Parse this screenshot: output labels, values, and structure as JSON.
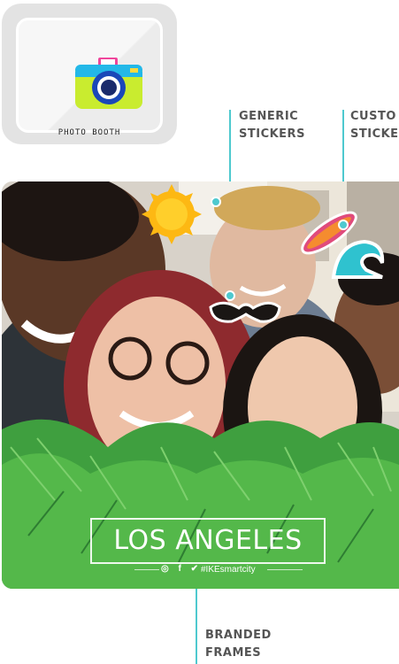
{
  "app_tile": {
    "label": "PHOTO BOOTH",
    "icon": "camera-icon"
  },
  "callouts": {
    "generic": "GENERIC\nSTICKERS",
    "custom": "CUSTO\nSTICKE",
    "branded": "BRANDED\nFRAMES"
  },
  "frame": {
    "city": "LOS ANGELES",
    "social_icons": "◎ f ✔",
    "hashtag": "#IKEsmartcity"
  },
  "stickers": [
    "sun-sticker",
    "mustache-sticker",
    "surfboard-sticker",
    "wave-sticker"
  ],
  "colors": {
    "accent": "#4ec9cf",
    "callout_text": "#555555",
    "leaf_green": "#3f9f3f"
  }
}
